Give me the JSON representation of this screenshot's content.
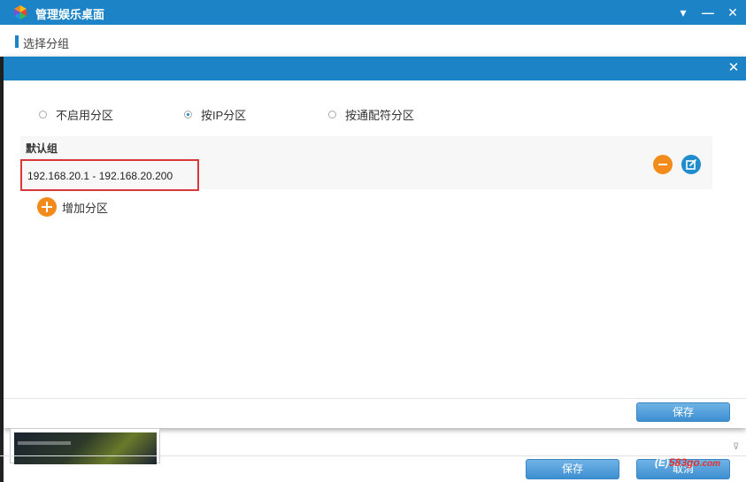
{
  "window": {
    "title": "管理娱乐桌面",
    "colors": {
      "titlebar": "#1c84c6",
      "accent_orange": "#f28b1b",
      "highlight_red": "#d9383a"
    }
  },
  "section": {
    "title": "选择分组"
  },
  "dialog": {
    "radio_options": [
      {
        "label": "不启用分区",
        "checked": false
      },
      {
        "label": "按IP分区",
        "checked": true
      },
      {
        "label": "按通配符分区",
        "checked": false
      }
    ],
    "group": {
      "title": "默认组",
      "ip_range": "192.168.20.1 - 192.168.20.200"
    },
    "add_partition_label": "增加分区",
    "save_label": "保存"
  },
  "footer": {
    "save_label": "保存",
    "cancel_label": "取消"
  },
  "watermark": {
    "prefix": "(E)",
    "num": "583go",
    "suffix": ".com"
  }
}
